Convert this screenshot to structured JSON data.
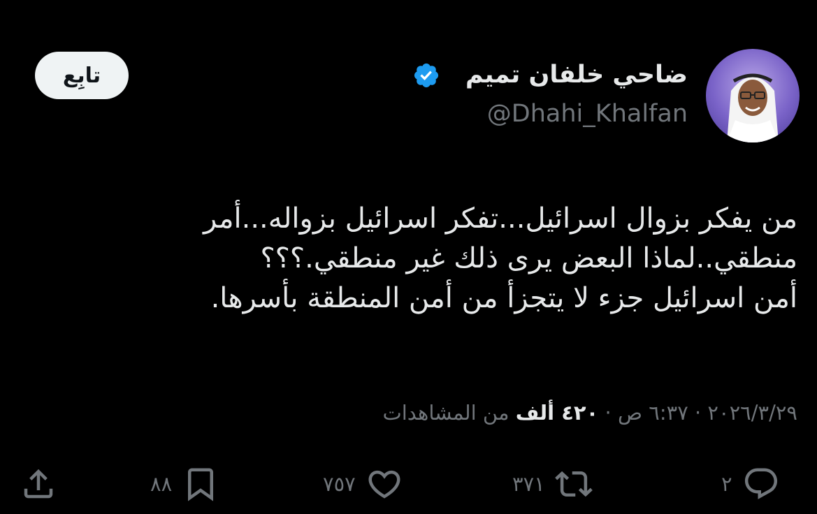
{
  "user": {
    "display_name": "ضاحي خلفان تميم",
    "handle": "@Dhahi_Khalfan",
    "verified_color": "#1d9bf0",
    "avatar_icon": "profile-photo"
  },
  "follow_button": {
    "label": "تابِع"
  },
  "tweet": {
    "lines": [
      "من يفكر بزوال اسرائيل...تفكر اسرائيل بزواله...أمر",
      "منطقي..لماذا البعض يرى ذلك غير منطقي.؟؟؟",
      "أمن اسرائيل جزء لا يتجزأ من أمن المنطقة بأسرها."
    ]
  },
  "meta": {
    "date": "٢٠٢٦/٣/٢٩",
    "separator": " · ",
    "time": "٦:٣٧ ص",
    "views_count": "٤٢٠ ألف",
    "views_label": " من المشاهدات"
  },
  "actions": {
    "replies": "٢",
    "retweets": "٣٧١",
    "likes": "٧٥٧",
    "bookmarks": "٨٨"
  },
  "colors": {
    "background": "#000000",
    "text_primary": "#e7e9ea",
    "text_secondary": "#71767b",
    "follow_bg": "#eff3f4"
  }
}
